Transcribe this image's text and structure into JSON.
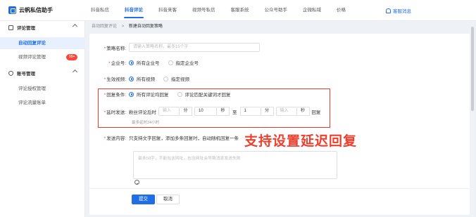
{
  "app": {
    "title": "云帆私信助手"
  },
  "nav": [
    {
      "label": "抖音私信",
      "active": false
    },
    {
      "label": "抖音评论",
      "active": true
    },
    {
      "label": "抖音来客",
      "active": false
    },
    {
      "label": "视频号私信",
      "active": false
    },
    {
      "label": "客服系统",
      "active": false
    },
    {
      "label": "公众号助手",
      "active": false
    },
    {
      "label": "企微私域",
      "active": false
    },
    {
      "label": "价格",
      "active": false
    }
  ],
  "notice_label": "客服消息",
  "sidebar": {
    "group1": "评论管理",
    "item_auto": "自动回复评论",
    "item_video": "视频评论管理",
    "video_badge": "99+",
    "group2": "账号管理",
    "item_auth": "评论授权管理",
    "item_flow": "评论流量账单"
  },
  "breadcrumb": {
    "parent": "自动回复评论",
    "sep": ">",
    "current": "新建自动回复策略"
  },
  "form": {
    "strategy_label": "策略名称:",
    "strategy_placeholder": "请输入策略名称，最多15个字",
    "account_label": "企业号:",
    "account_opt1": "所有企业号",
    "account_opt2": "指定企业号",
    "video_label": "生效视频:",
    "video_opt1": "所有视频",
    "video_opt2": "指定视频",
    "condition_label": "回复条件:",
    "condition_opt1": "所有评论均回复",
    "condition_opt2": "评论匹配关键词才回复",
    "delay_label": "延时发送:",
    "delay_prefix": "粉丝评论后时",
    "delay_in1_placeholder": "输入",
    "delay_unit_min": "分",
    "delay_sec_value": "10",
    "delay_unit_sec": "秒",
    "delay_to": "至",
    "delay_min_value": "1",
    "delay_unit_min2": "分",
    "delay_in2_placeholder": "输入",
    "delay_unit_sec2": "秒",
    "delay_suffix": "回复",
    "delay_hint": "最多延时24小时",
    "content_label": "发送内容:",
    "content_desc": "只支持文字回复，添加多条回复时，自动随机回复一条",
    "content_placeholder": "最多50字，不能包含网址，包含网址会导致消息发送失败"
  },
  "annotation": "支持设置延迟回复",
  "buttons": {
    "submit": "提交",
    "cancel": "取消"
  },
  "colors": {
    "primary": "#1f6ee8",
    "highlight": "#e53a2e",
    "annotation": "#ee3f2c",
    "badge": "#f5493b"
  }
}
